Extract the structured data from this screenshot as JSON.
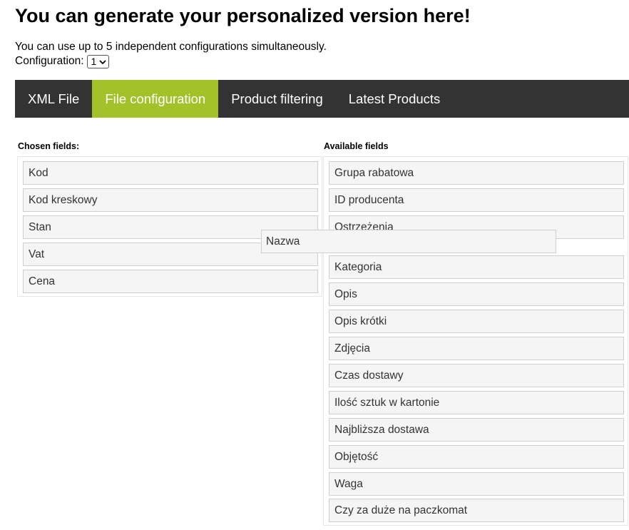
{
  "header": {
    "title": "You can generate your personalized version here!",
    "intro": "You can use up to 5 independent configurations simultaneously.",
    "config_label": "Configuration:",
    "config_value": "1"
  },
  "tabs": [
    {
      "label": "XML File",
      "active": false
    },
    {
      "label": "File configuration",
      "active": true
    },
    {
      "label": "Product filtering",
      "active": false
    },
    {
      "label": "Latest Products",
      "active": false
    }
  ],
  "chosen": {
    "label": "Chosen fields:",
    "items": [
      "Kod",
      "Kod kreskowy",
      "Stan",
      "Vat",
      "Cena"
    ]
  },
  "available": {
    "label": "Available fields",
    "items": [
      "Grupa rabatowa",
      "ID producenta",
      "Ostrzeżenia",
      "Kategoria",
      "Opis",
      "Opis krótki",
      "Zdjęcia",
      "Czas dostawy",
      "Ilość sztuk w kartonie",
      "Najbliższa dostawa",
      "Objętość",
      "Waga",
      "Czy za duże na paczkomat"
    ]
  },
  "dragging": {
    "label": "Nazwa"
  },
  "colors": {
    "tab_bar": "#333333",
    "tab_active": "#a3c22a",
    "field_bg": "#f5f5f5",
    "field_border": "#cfcfcf"
  }
}
